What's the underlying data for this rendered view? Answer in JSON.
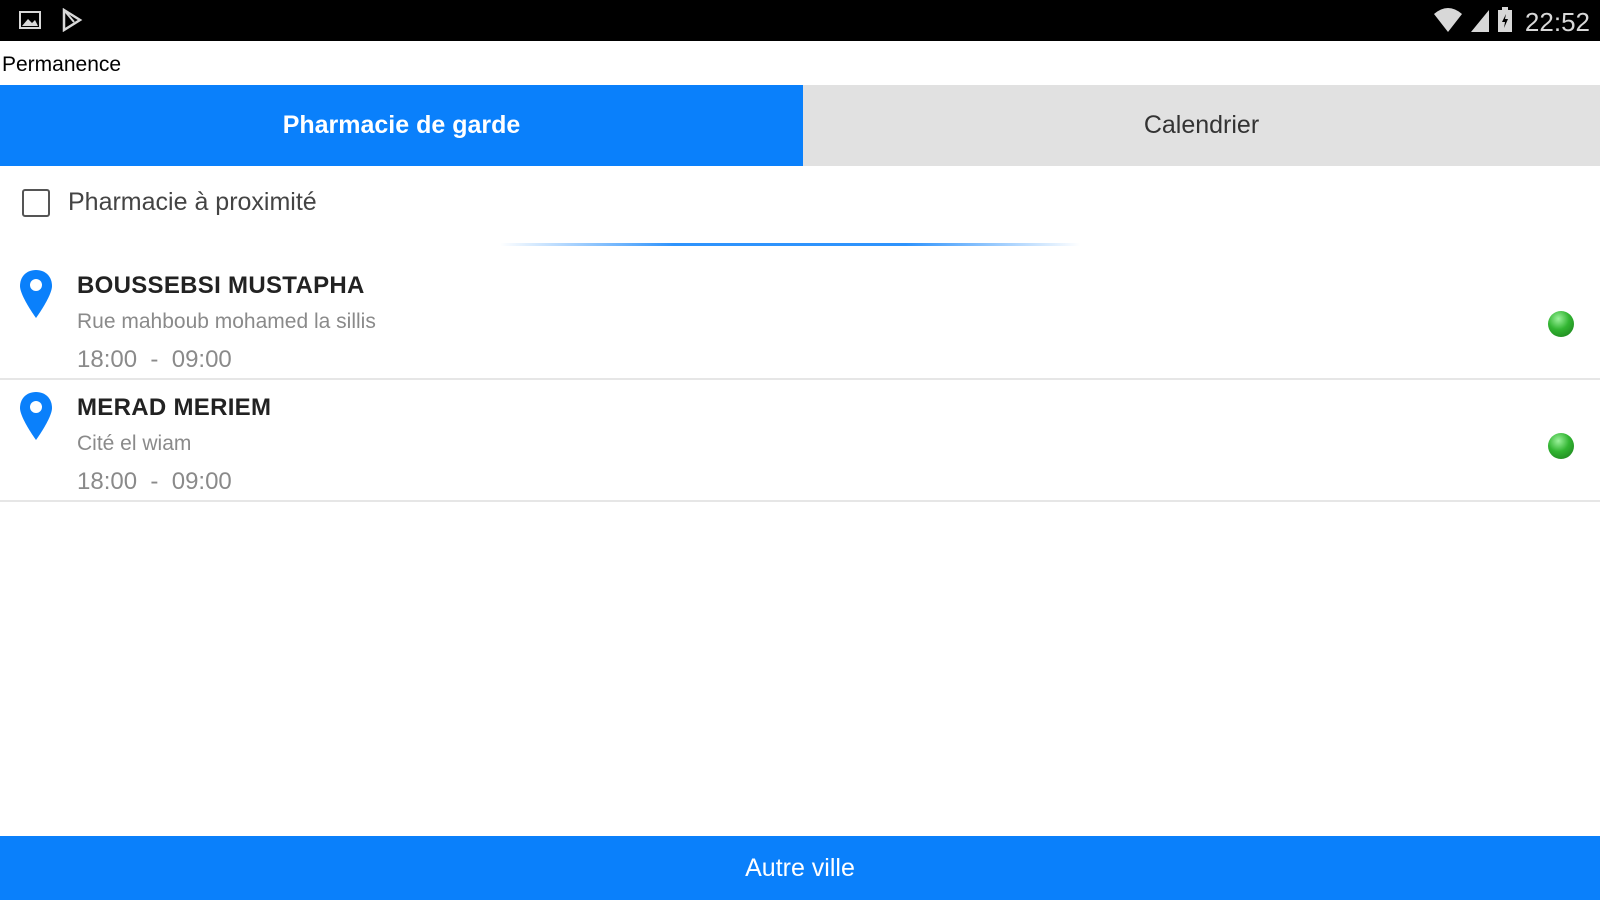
{
  "status_bar": {
    "left_icons": [
      "image-icon",
      "play-store-icon"
    ],
    "right_icons": [
      "wifi-icon",
      "signal-icon",
      "battery-icon"
    ],
    "time": "22:52"
  },
  "title_bar": {
    "title": "Permanence"
  },
  "tabs": [
    {
      "label": "Pharmacie de garde",
      "active": true
    },
    {
      "label": "Calendrier",
      "active": false
    }
  ],
  "proximity": {
    "label": "Pharmacie à proximité",
    "checked": false
  },
  "pharmacies": [
    {
      "name": "BOUSSEBSI MUSTAPHA",
      "address": "Rue mahboub mohamed la sillis",
      "hours": "18:00  -  09:00",
      "status_color": "#32b532"
    },
    {
      "name": "MERAD MERIEM",
      "address": "Cité el wiam",
      "hours": "18:00  -  09:00",
      "status_color": "#32b532"
    }
  ],
  "bottom_button": {
    "label": "Autre ville"
  },
  "colors": {
    "accent": "#0a80fb",
    "tab_inactive": "#e1e1e1",
    "status_bar": "#000000"
  }
}
